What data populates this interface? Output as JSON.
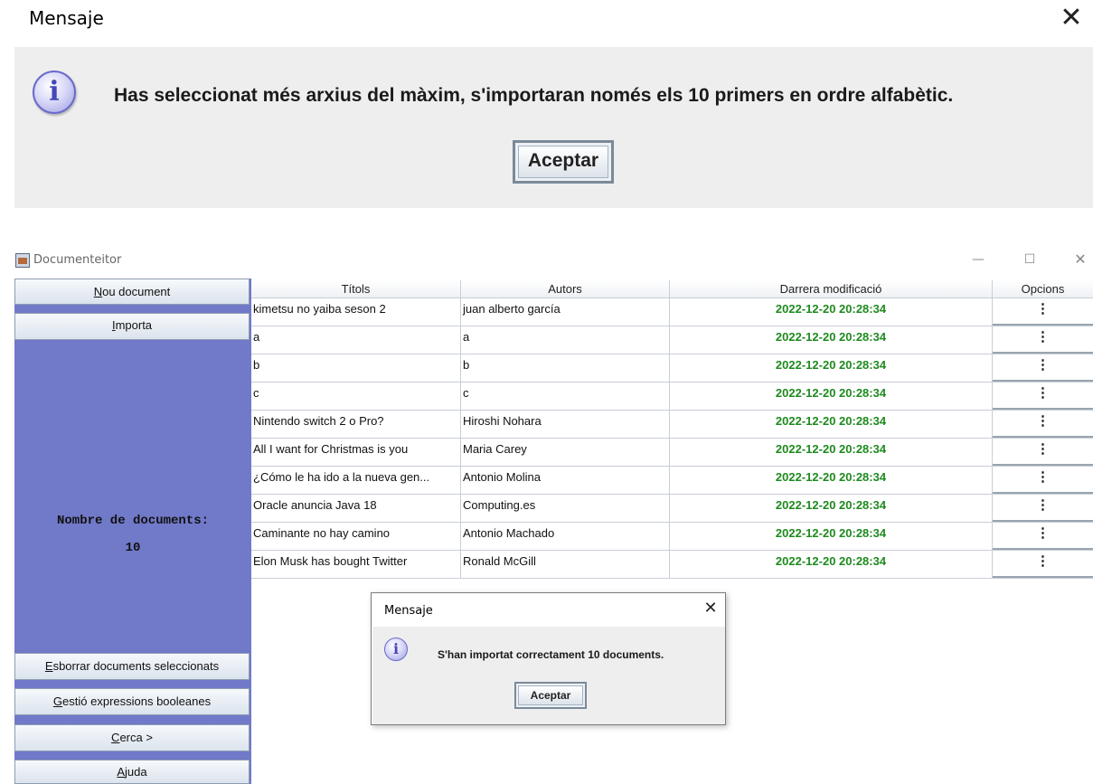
{
  "top_dialog": {
    "title": "Mensaje",
    "close_glyph": "✕",
    "icon": "info-icon",
    "message": "Has seleccionat més arxius del màxim, s'importaran només els 10 primers en ordre alfabètic.",
    "button_label": "Aceptar"
  },
  "window": {
    "title": "Documenteitor",
    "minimize_glyph": "—",
    "maximize_glyph": "☐",
    "close_glyph": "✕"
  },
  "sidebar": {
    "new_document": {
      "mnemonic": "N",
      "rest": "ou document"
    },
    "import": {
      "mnemonic": "I",
      "rest": "mporta"
    },
    "count_label": "Nombre de documents:",
    "count_value": "10",
    "delete_selected": {
      "mnemonic": "E",
      "rest": "sborrar documents seleccionats"
    },
    "boolean_expressions": {
      "mnemonic": "G",
      "rest": "estió expressions booleanes"
    },
    "search": {
      "mnemonic": "C",
      "rest": "erca >"
    },
    "help": {
      "mnemonic": "A",
      "rest": "juda"
    }
  },
  "table": {
    "columns": [
      "Títols",
      "Autors",
      "Darrera modificació",
      "Opcions"
    ],
    "option_glyph": "⋮",
    "rows": [
      {
        "title": "kimetsu no yaiba seson 2",
        "author": "juan alberto garcía",
        "modified": "2022-12-20 20:28:34"
      },
      {
        "title": "a",
        "author": "a",
        "modified": "2022-12-20 20:28:34"
      },
      {
        "title": "b",
        "author": "b",
        "modified": "2022-12-20 20:28:34"
      },
      {
        "title": "c",
        "author": "c",
        "modified": "2022-12-20 20:28:34"
      },
      {
        "title": "Nintendo switch 2 o Pro?",
        "author": "Hiroshi Nohara",
        "modified": "2022-12-20 20:28:34"
      },
      {
        "title": "All I want for Christmas is you",
        "author": "Maria Carey",
        "modified": "2022-12-20 20:28:34"
      },
      {
        "title": "¿Cómo le ha ido a la nueva gen...",
        "author": "Antonio Molina",
        "modified": "2022-12-20 20:28:34"
      },
      {
        "title": "Oracle anuncia Java 18",
        "author": "Computing.es",
        "modified": "2022-12-20 20:28:34"
      },
      {
        "title": "Caminante no hay camino",
        "author": "Antonio Machado",
        "modified": "2022-12-20 20:28:34"
      },
      {
        "title": "Elon Musk has bought Twitter",
        "author": "Ronald McGill",
        "modified": "2022-12-20 20:28:34"
      }
    ]
  },
  "small_dialog": {
    "title": "Mensaje",
    "close_glyph": "✕",
    "icon": "info-icon",
    "message": "S'han importat correctament 10 documents.",
    "button_label": "Aceptar"
  },
  "colors": {
    "sidebar_bg": "#7179c9",
    "date_text": "#1e8a1e",
    "dialog_bg": "#eeeeee"
  }
}
